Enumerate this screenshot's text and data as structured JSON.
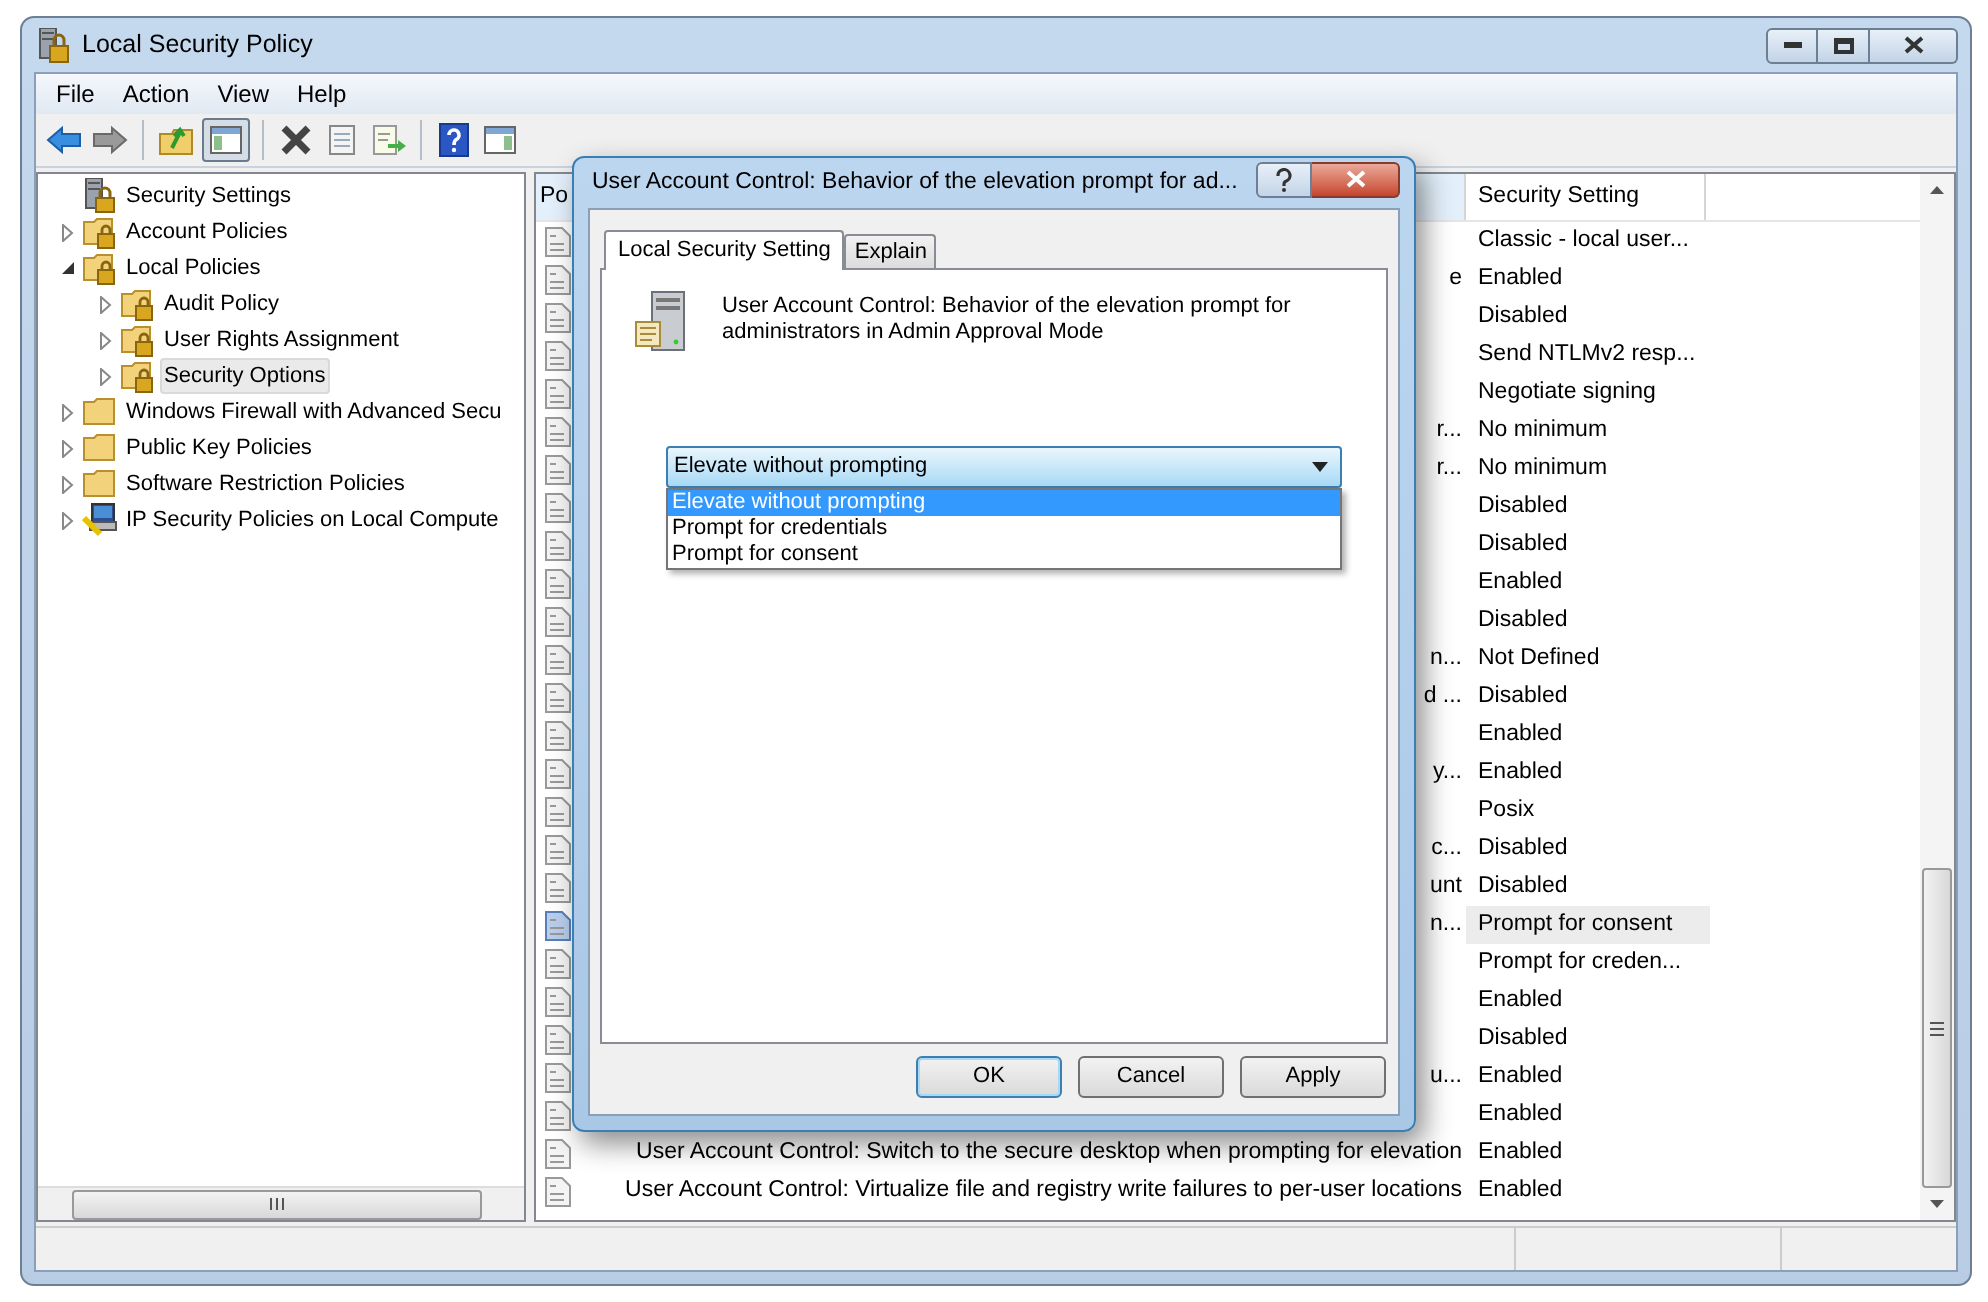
{
  "window": {
    "title": "Local Security Policy"
  },
  "menu": [
    "File",
    "Action",
    "View",
    "Help"
  ],
  "tree": [
    {
      "label": "Security Settings",
      "kind": "root",
      "selected": false,
      "children": [
        {
          "label": "Account Policies",
          "kind": "secure-folder",
          "expanded": false,
          "selected": false
        },
        {
          "label": "Local Policies",
          "kind": "secure-folder",
          "expanded": true,
          "selected": false,
          "children": [
            {
              "label": "Audit Policy",
              "kind": "secure-folder",
              "expanded": false,
              "selected": false
            },
            {
              "label": "User Rights Assignment",
              "kind": "secure-folder",
              "expanded": false,
              "selected": false
            },
            {
              "label": "Security Options",
              "kind": "secure-folder",
              "expanded": false,
              "selected": true
            }
          ]
        },
        {
          "label": "Windows Firewall with Advanced Secu",
          "kind": "folder",
          "expanded": false,
          "selected": false
        },
        {
          "label": "Public Key Policies",
          "kind": "folder",
          "expanded": false,
          "selected": false
        },
        {
          "label": "Software Restriction Policies",
          "kind": "folder",
          "expanded": false,
          "selected": false
        },
        {
          "label": "IP Security Policies on Local Compute",
          "kind": "ip-policy",
          "expanded": false,
          "selected": false
        }
      ]
    }
  ],
  "list": {
    "columns": [
      "Po",
      "Security Setting"
    ],
    "rows": [
      {
        "setting": "Classic - local user...",
        "selected": false
      },
      {
        "policy": "e",
        "setting": "Enabled",
        "selected": false
      },
      {
        "setting": "Disabled",
        "selected": false
      },
      {
        "setting": "Send NTLMv2 resp...",
        "selected": false
      },
      {
        "setting": "Negotiate signing",
        "selected": false
      },
      {
        "policy": "r...",
        "setting": "No minimum",
        "selected": false
      },
      {
        "policy": "r...",
        "setting": "No minimum",
        "selected": false
      },
      {
        "setting": "Disabled",
        "selected": false
      },
      {
        "setting": "Disabled",
        "selected": false
      },
      {
        "setting": "Enabled",
        "selected": false
      },
      {
        "setting": "Disabled",
        "selected": false
      },
      {
        "policy": "n...",
        "setting": "Not Defined",
        "selected": false
      },
      {
        "policy": "d ...",
        "setting": "Disabled",
        "selected": false
      },
      {
        "setting": "Enabled",
        "selected": false
      },
      {
        "policy": "y...",
        "setting": "Enabled",
        "selected": false
      },
      {
        "setting": "Posix",
        "selected": false
      },
      {
        "policy": "c...",
        "setting": "Disabled",
        "selected": false
      },
      {
        "policy": "unt",
        "setting": "Disabled",
        "selected": false
      },
      {
        "policy": "n...",
        "setting": "Prompt for consent",
        "selected": true
      },
      {
        "setting": "Prompt for creden...",
        "selected": false
      },
      {
        "setting": "Enabled",
        "selected": false
      },
      {
        "setting": "Disabled",
        "selected": false
      },
      {
        "policy": "u...",
        "setting": "Enabled",
        "selected": false
      },
      {
        "setting": "Enabled",
        "selected": false
      },
      {
        "policy": "User Account Control: Switch to the secure desktop when prompting for elevation",
        "setting": "Enabled",
        "selected": false
      },
      {
        "policy": "User Account Control: Virtualize file and registry write failures to per-user locations",
        "setting": "Enabled",
        "selected": false
      }
    ]
  },
  "dialog": {
    "title": "User Account Control: Behavior of the elevation prompt for ad...",
    "tabs": [
      {
        "label": "Local Security Setting",
        "selected": true
      },
      {
        "label": "Explain",
        "selected": false
      }
    ],
    "description": "User Account Control: Behavior of the elevation prompt for administrators in Admin Approval Mode",
    "dropdown": {
      "value": "Elevate without prompting",
      "expanded": true,
      "options": [
        {
          "label": "Elevate without prompting",
          "selected": true
        },
        {
          "label": "Prompt for credentials",
          "selected": false
        },
        {
          "label": "Prompt for consent",
          "selected": false
        }
      ]
    },
    "buttons": [
      "OK",
      "Cancel",
      "Apply"
    ]
  }
}
